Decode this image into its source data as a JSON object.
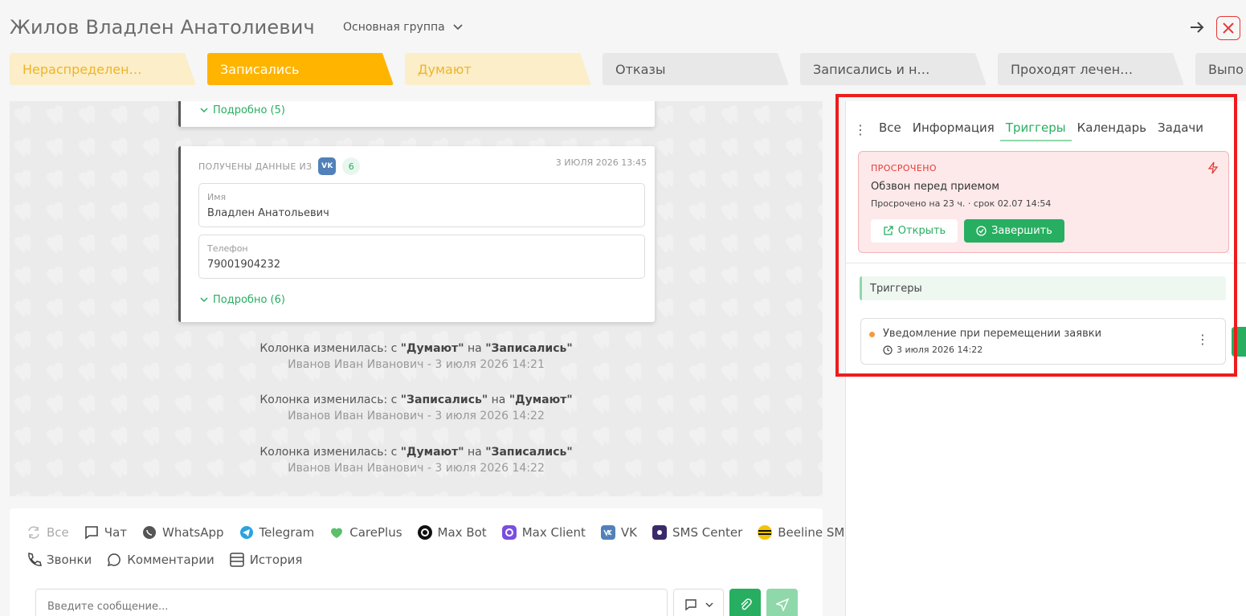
{
  "header": {
    "client_name": "Жилов Владлен Анатолиевич",
    "group": "Основная группа"
  },
  "stages": [
    {
      "label": "Нераспределен…",
      "state": "light"
    },
    {
      "label": "Записались",
      "state": "active"
    },
    {
      "label": "Думают",
      "state": "light"
    },
    {
      "label": "Отказы",
      "state": "gray"
    },
    {
      "label": "Записались и н…",
      "state": "gray"
    },
    {
      "label": "Проходят лечен…",
      "state": "gray"
    },
    {
      "label": "Выпо",
      "state": "gray"
    }
  ],
  "feed": {
    "card1": {
      "more": "Подробно (5)"
    },
    "card2": {
      "source_label": "ПОЛУЧЕНЫ ДАННЫЕ ИЗ",
      "source_badge": "VK",
      "count": "6",
      "date": "3 ИЮЛЯ 2026 13:45",
      "fields": [
        {
          "label": "Имя",
          "value": "Владлен Анатольевич"
        },
        {
          "label": "Телефон",
          "value": "79001904232"
        }
      ],
      "more": "Подробно (6)"
    },
    "events": [
      {
        "prefix": "Колонка изменилась: с ",
        "from": "\"Думают\"",
        "mid": " на ",
        "to": "\"Записались\"",
        "meta": "Иванов Иван Иванович - 3 июля 2026 14:21"
      },
      {
        "prefix": "Колонка изменилась: с ",
        "from": "\"Записались\"",
        "mid": " на ",
        "to": "\"Думают\"",
        "meta": "Иванов Иван Иванович - 3 июля 2026 14:22"
      },
      {
        "prefix": "Колонка изменилась: с ",
        "from": "\"Думают\"",
        "mid": " на ",
        "to": "\"Записались\"",
        "meta": "Иванов Иван Иванович - 3 июля 2026 14:22"
      }
    ]
  },
  "composer": {
    "channels_row1": [
      "Все",
      "Чат",
      "WhatsApp",
      "Telegram",
      "CarePlus",
      "Max Bot",
      "Max Client",
      "VK",
      "SMS Center",
      "Beeline SMS"
    ],
    "channels_row2": [
      "Звонки",
      "Комментарии",
      "История"
    ],
    "placeholder": "Введите сообщение..."
  },
  "right_panel": {
    "tabs": [
      "Все",
      "Информация",
      "Триггеры",
      "Календарь",
      "Задачи"
    ],
    "active_tab": "Триггеры",
    "overdue": {
      "label": "ПРОСРОЧЕНО",
      "title": "Обзвон перед приемом",
      "subtitle": "Просрочено на 23 ч. · срок 02.07 14:54",
      "open_button": "Открыть",
      "done_button": "Завершить"
    },
    "section_title": "Триггеры",
    "trigger": {
      "title": "Уведомление при перемещении заявки",
      "date": "3 июля 2026 14:22"
    }
  },
  "colors": {
    "accent": "#27ae60",
    "active_stage": "#ffb400",
    "highlight": "#ee1c1c",
    "overdue": "#e53935"
  }
}
